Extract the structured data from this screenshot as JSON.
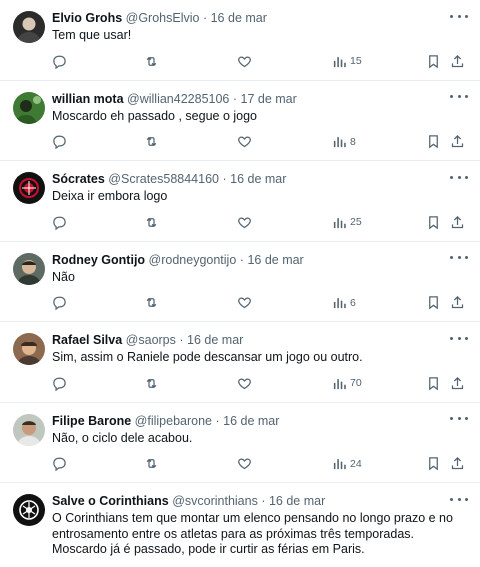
{
  "tweets": [
    {
      "name": "Elvio Grohs",
      "handle": "@GrohsElvio",
      "date": "16 de mar",
      "text": "Tem que usar!",
      "views": "15",
      "avatar_bg": "#2b2b2b",
      "avatar_fg": "#d9c7b5"
    },
    {
      "name": "willian mota",
      "handle": "@willian42285106",
      "date": "17 de mar",
      "text": "Moscardo eh passado , segue o jogo",
      "views": "8",
      "avatar_bg": "#3f7a34",
      "avatar_fg": "#1d2d18"
    },
    {
      "name": "Sócrates",
      "handle": "@Scrates58844160",
      "date": "16 de mar",
      "text": "Deixa ir embora logo",
      "views": "25",
      "avatar_bg": "#111111",
      "avatar_fg": "#c8102e"
    },
    {
      "name": "Rodney Gontijo",
      "handle": "@rodneygontijo",
      "date": "16 de mar",
      "text": "Não",
      "views": "6",
      "avatar_bg": "#5e6b62",
      "avatar_fg": "#d8b899"
    },
    {
      "name": "Rafael Silva",
      "handle": "@saorps",
      "date": "16 de mar",
      "text": "Sim, assim o Raniele pode descansar um jogo ou outro.",
      "views": "70",
      "avatar_bg": "#8c6a4f",
      "avatar_fg": "#e0b48f"
    },
    {
      "name": "Filipe Barone",
      "handle": "@filipebarone",
      "date": "16 de mar",
      "text": "Não, o ciclo dele acabou.",
      "views": "24",
      "avatar_bg": "#bfc7bf",
      "avatar_fg": "#c99b7d"
    },
    {
      "name": "Salve o Corinthians",
      "handle": "@svcorinthians",
      "date": "16 de mar",
      "text": "O  Corinthians tem que montar um elenco pensando no longo prazo e no entrosamento entre os atletas para as próximas três temporadas. Moscardo já é passado, pode ir curtir as férias em Paris.",
      "views": "",
      "avatar_bg": "#111111",
      "avatar_fg": "#ffffff"
    }
  ],
  "separator": "·",
  "colors": {
    "text": "#0f1419",
    "secondary": "#536471",
    "divider": "#e6ecf0"
  }
}
